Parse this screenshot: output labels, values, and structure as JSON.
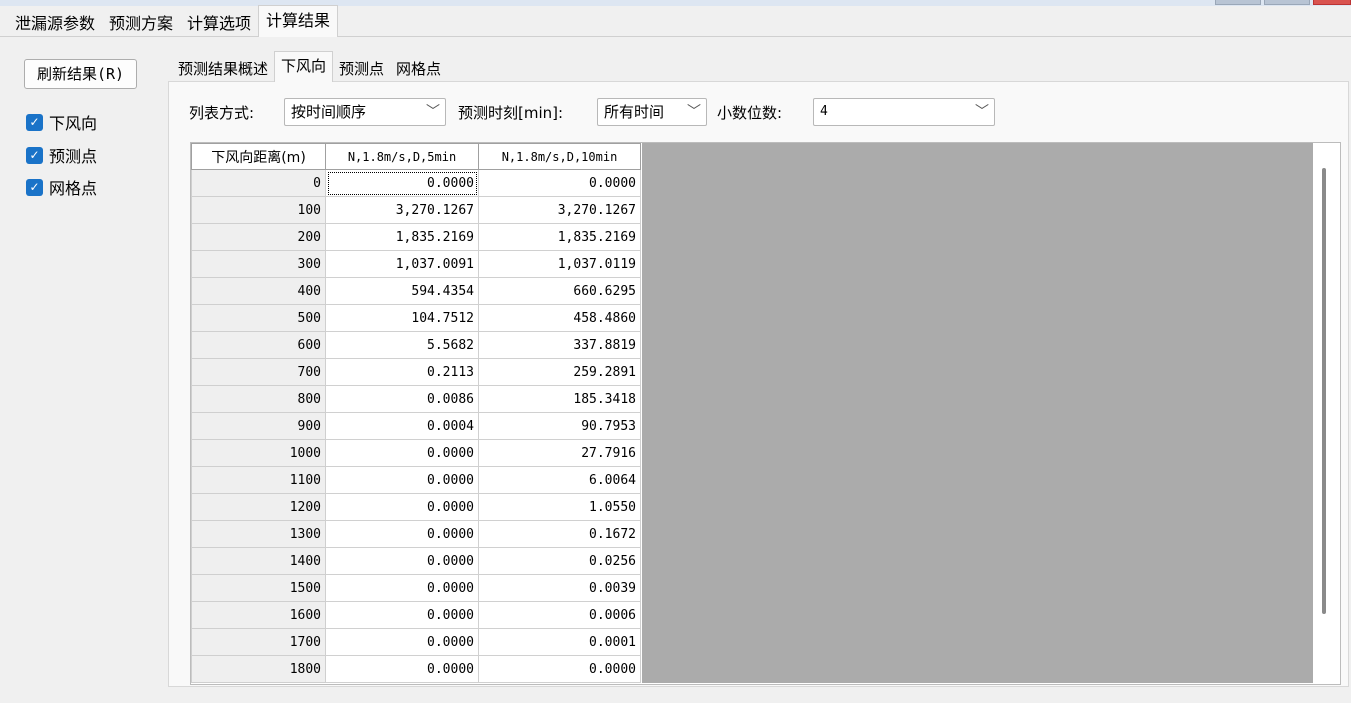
{
  "top_tabs": [
    "泄漏源参数",
    "预测方案",
    "计算选项",
    "计算结果"
  ],
  "refresh_button": "刷新结果(R)",
  "checkboxes": [
    {
      "label": "下风向",
      "checked": true
    },
    {
      "label": "预测点",
      "checked": true
    },
    {
      "label": "网格点",
      "checked": true
    }
  ],
  "inner_tabs": [
    "预测结果概述",
    "下风向",
    "预测点",
    "网格点"
  ],
  "controls": {
    "list_mode_label": "列表方式:",
    "list_mode_value": "按时间顺序",
    "time_label": "预测时刻[min]:",
    "time_value": "所有时间",
    "decimals_label": "小数位数:",
    "decimals_value": "4"
  },
  "table": {
    "headers": [
      "下风向距离(m)",
      "N,1.8m/s,D,5min",
      "N,1.8m/s,D,10min"
    ],
    "rows": [
      [
        "0",
        "0.0000",
        "0.0000"
      ],
      [
        "100",
        "3,270.1267",
        "3,270.1267"
      ],
      [
        "200",
        "1,835.2169",
        "1,835.2169"
      ],
      [
        "300",
        "1,037.0091",
        "1,037.0119"
      ],
      [
        "400",
        "594.4354",
        "660.6295"
      ],
      [
        "500",
        "104.7512",
        "458.4860"
      ],
      [
        "600",
        "5.5682",
        "337.8819"
      ],
      [
        "700",
        "0.2113",
        "259.2891"
      ],
      [
        "800",
        "0.0086",
        "185.3418"
      ],
      [
        "900",
        "0.0004",
        "90.7953"
      ],
      [
        "1000",
        "0.0000",
        "27.7916"
      ],
      [
        "1100",
        "0.0000",
        "6.0064"
      ],
      [
        "1200",
        "0.0000",
        "1.0550"
      ],
      [
        "1300",
        "0.0000",
        "0.1672"
      ],
      [
        "1400",
        "0.0000",
        "0.0256"
      ],
      [
        "1500",
        "0.0000",
        "0.0039"
      ],
      [
        "1600",
        "0.0000",
        "0.0006"
      ],
      [
        "1700",
        "0.0000",
        "0.0001"
      ],
      [
        "1800",
        "0.0000",
        "0.0000"
      ]
    ]
  },
  "colors": {
    "checkbox": "#1a73c8",
    "grid_background": "#ababab"
  }
}
